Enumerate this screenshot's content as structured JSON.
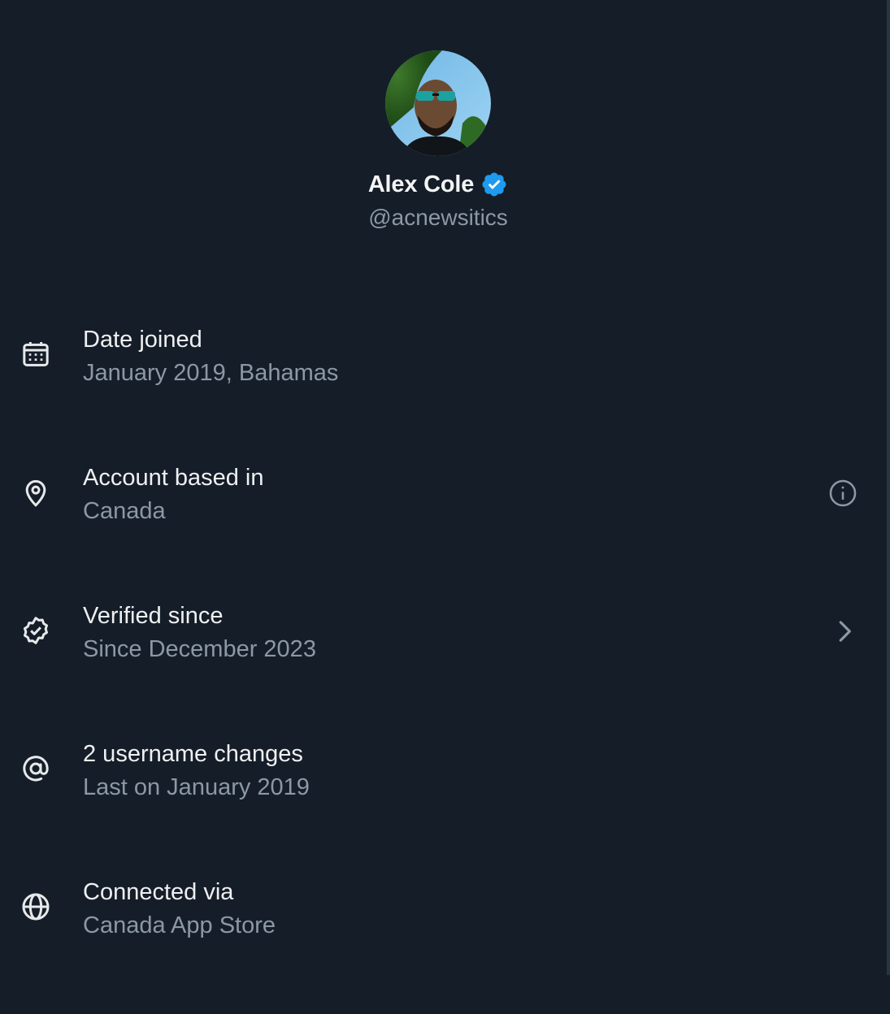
{
  "profile": {
    "display_name": "Alex Cole",
    "handle": "@acnewsitics",
    "verified_color": "#1d9bf0"
  },
  "rows": [
    {
      "icon": "calendar-icon",
      "title": "Date joined",
      "subtitle": "January 2019, Bahamas"
    },
    {
      "icon": "location-pin-icon",
      "title": "Account based in",
      "subtitle": "Canada",
      "action_icon": "info-icon"
    },
    {
      "icon": "verified-check-icon",
      "title": "Verified since",
      "subtitle": "Since December 2023",
      "action_icon": "chevron-right-icon"
    },
    {
      "icon": "at-sign-icon",
      "title": "2 username changes",
      "subtitle": "Last on January 2019"
    },
    {
      "icon": "globe-icon",
      "title": "Connected via",
      "subtitle": "Canada App Store"
    }
  ],
  "colors": {
    "background": "#151d28",
    "primary_text": "#e7e9ea",
    "secondary_text": "#8b98a5",
    "accent": "#1d9bf0"
  }
}
